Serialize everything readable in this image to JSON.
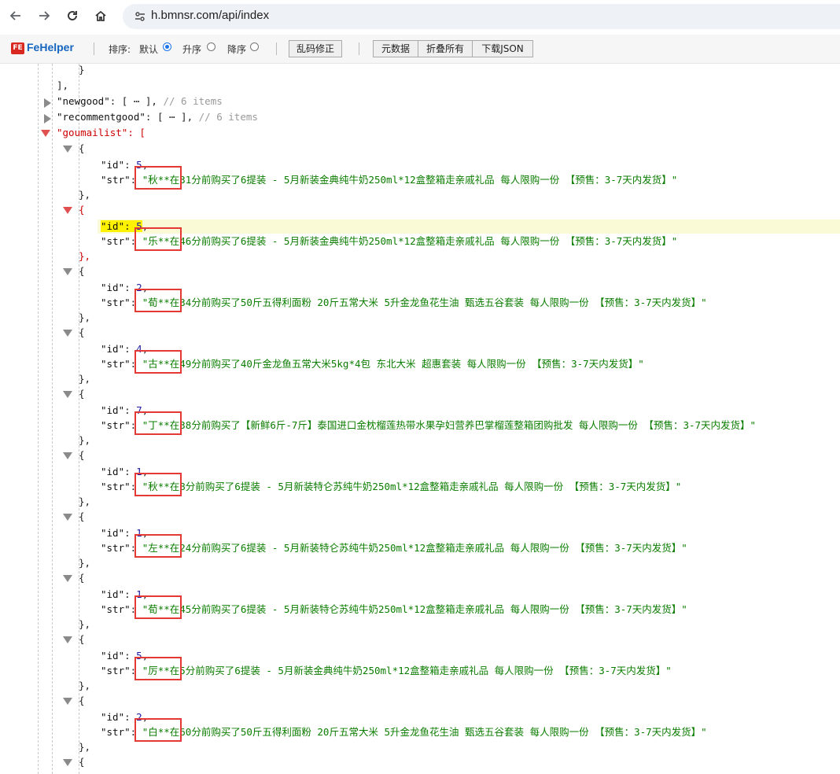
{
  "browser": {
    "url": "h.bmnsr.com/api/index",
    "back_icon": "arrow-left-icon",
    "forward_icon": "arrow-right-icon",
    "reload_icon": "reload-icon",
    "home_icon": "home-icon",
    "site_info_icon": "tune-icon"
  },
  "toolbar": {
    "logo_text": "FE",
    "title": "FeHelper",
    "sort_label": "排序:",
    "sort_default": "默认",
    "sort_asc": "升序",
    "sort_desc": "降序",
    "sort_selected": "默认",
    "fix_encoding_button": "乱码修正",
    "raw_button": "元数据",
    "collapse_button": "折叠所有",
    "download_button": "下载JSON"
  },
  "json": {
    "prev_close_brace": "}",
    "prev_close_bracket": "],",
    "collapsed": [
      {
        "key": "\"newgood\"",
        "summary": "[ ⋯ ],",
        "comment": "// 6 items"
      },
      {
        "key": "\"recommentgood\"",
        "summary": "[ ⋯ ],",
        "comment": "// 6 items"
      }
    ],
    "list_key": "\"goumailist\"",
    "list_open": "[",
    "id_key": "\"id\"",
    "str_key": "\"str\"",
    "items": [
      {
        "id": "5",
        "str": "\"秋**在31分前购买了6提装 - 5月新装金典纯牛奶250ml*12盒整箱走亲戚礼品 每人限购一份 【预售：3-7天内发货】\""
      },
      {
        "id": "5",
        "str": "\"乐**在46分前购买了6提装 - 5月新装金典纯牛奶250ml*12盒整箱走亲戚礼品 每人限购一份 【预售：3-7天内发货】\""
      },
      {
        "id": "2",
        "str": "\"荀**在34分前购买了50斤五得利面粉 20斤五常大米 5升金龙鱼花生油 甄选五谷套装 每人限购一份 【预售：3-7天内发货】\""
      },
      {
        "id": "4",
        "str": "\"古**在49分前购买了40斤金龙鱼五常大米5kg*4包 东北大米 超惠套装 每人限购一份 【预售：3-7天内发货】\""
      },
      {
        "id": "7",
        "str": "\"丁**在38分前购买了【新鲜6斤-7斤】泰国进口金枕榴莲热带水果孕妇营养巴掌榴莲整箱团购批发 每人限购一份 【预售：3-7天内发货】\""
      },
      {
        "id": "1",
        "str": "\"秋**在8分前购买了6提装 - 5月新装特仑苏纯牛奶250ml*12盒整箱走亲戚礼品 每人限购一份 【预售：3-7天内发货】\""
      },
      {
        "id": "1",
        "str": "\"左**在24分前购买了6提装 - 5月新装特仑苏纯牛奶250ml*12盒整箱走亲戚礼品 每人限购一份 【预售：3-7天内发货】\""
      },
      {
        "id": "1",
        "str": "\"荀**在45分前购买了6提装 - 5月新装特仑苏纯牛奶250ml*12盒整箱走亲戚礼品 每人限购一份 【预售：3-7天内发货】\""
      },
      {
        "id": "5",
        "str": "\"厉**在5分前购买了6提装 - 5月新装金典纯牛奶250ml*12盒整箱走亲戚礼品 每人限购一份 【预售：3-7天内发货】\""
      },
      {
        "id": "2",
        "str": "\"白**在60分前购买了50斤五得利面粉 20斤五常大米 5升金龙鱼花生油 甄选五谷套装 每人限购一份 【预售：3-7天内发货】\""
      }
    ],
    "highlighted_item": 1
  },
  "colors": {
    "string": "#0b7d00",
    "number": "#1a1aa6",
    "annotation_box": "#e53935",
    "key_highlight": "#fff200"
  }
}
